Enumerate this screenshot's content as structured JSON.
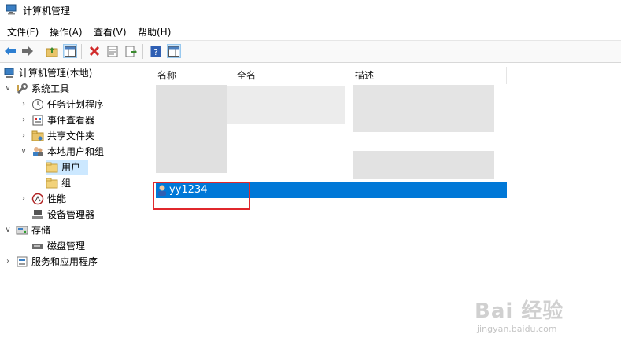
{
  "window": {
    "title": "计算机管理"
  },
  "menu": [
    "文件(F)",
    "操作(A)",
    "查看(V)",
    "帮助(H)"
  ],
  "tree": {
    "root": "计算机管理(本地)",
    "system_tools": "系统工具",
    "task_scheduler": "任务计划程序",
    "event_viewer": "事件查看器",
    "shared_folders": "共享文件夹",
    "local_users_groups": "本地用户和组",
    "users": "用户",
    "groups": "组",
    "performance": "性能",
    "device_manager": "设备管理器",
    "storage": "存储",
    "disk_management": "磁盘管理",
    "services_apps": "服务和应用程序"
  },
  "list": {
    "columns": [
      "名称",
      "全名",
      "描述"
    ],
    "selected_user": "yy1234"
  },
  "watermark": {
    "brand": "Bai 经验",
    "url": "jingyan.baidu.com"
  },
  "colors": {
    "selection": "#0078d7",
    "tree_selection": "#cce8ff",
    "highlight_box": "#e0282c"
  }
}
